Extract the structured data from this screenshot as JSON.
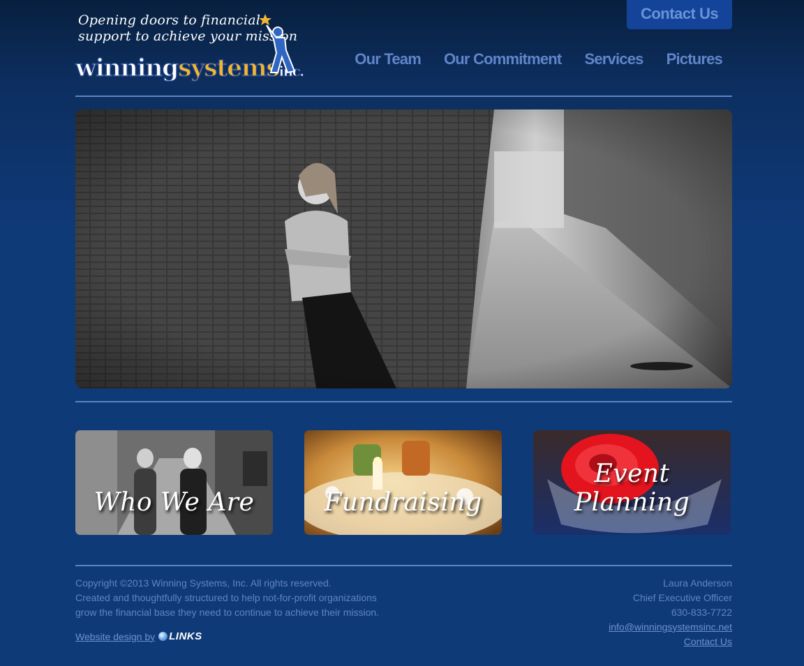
{
  "header": {
    "tagline_line1": "Opening doors to financial",
    "tagline_line2": "support to achieve your mission",
    "brand_winning": "winning",
    "brand_systems": "systems",
    "brand_inc": "inc.",
    "contact_button": "Contact Us",
    "nav": [
      "Our Team",
      "Our Commitment",
      "Services",
      "Pictures"
    ]
  },
  "tiles": [
    {
      "label": "Who We Are"
    },
    {
      "label": "Fundraising"
    },
    {
      "label": "Event Planning"
    }
  ],
  "footer": {
    "copyright": "Copyright ©2013 Winning Systems, Inc. All rights reserved.",
    "desc_line1": "Created and thoughtfully structured to help not-for-profit organizations",
    "desc_line2": "grow the financial base they need to continue to achieve their mission.",
    "credit_text": "Website design by",
    "credit_logo": "LINKS",
    "contact_name": "Laura Anderson",
    "contact_title": "Chief Executive Officer",
    "contact_phone": "630-833-7722",
    "contact_email": "info@winningsystemsinc.net",
    "contact_link": "Contact Us"
  },
  "colors": {
    "background": "#0f3a78",
    "nav_text": "#6085c9",
    "contact_button_bg": "#13449a",
    "brand_gold": "#f3b631",
    "footer_text": "#5f85c0"
  }
}
